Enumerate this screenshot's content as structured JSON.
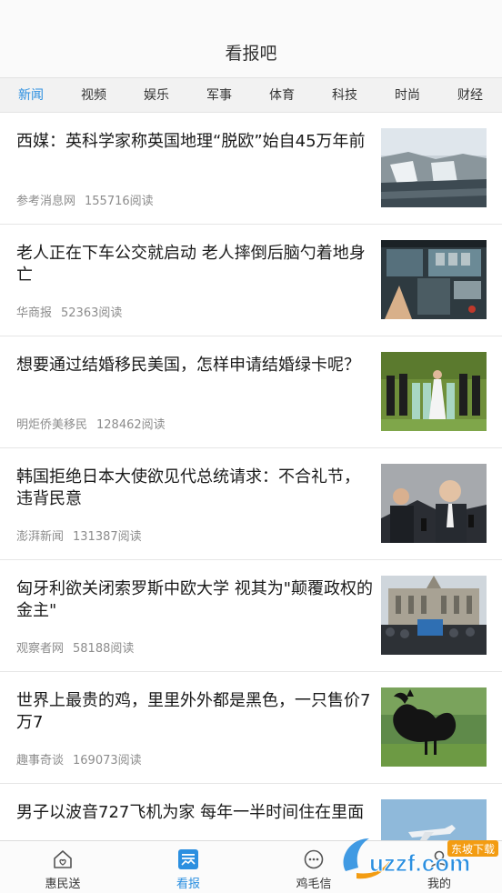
{
  "header": {
    "title": "看报吧"
  },
  "tabs": [
    {
      "label": "新闻",
      "active": true
    },
    {
      "label": "视频"
    },
    {
      "label": "娱乐"
    },
    {
      "label": "军事"
    },
    {
      "label": "体育"
    },
    {
      "label": "科技"
    },
    {
      "label": "时尚"
    },
    {
      "label": "财经"
    }
  ],
  "articles": [
    {
      "headline": "西媒：英科学家称英国地理“脱欧”始自45万年前",
      "source": "参考消息网",
      "reads": "155716阅读"
    },
    {
      "headline": "老人正在下车公交就启动 老人摔倒后脑勺着地身亡",
      "source": "华商报",
      "reads": "52363阅读"
    },
    {
      "headline": "想要通过结婚移民美国，怎样申请结婚绿卡呢？",
      "source": "明炬侨美移民",
      "reads": "128462阅读"
    },
    {
      "headline": "韩国拒绝日本大使欲见代总统请求：不合礼节，违背民意",
      "source": "澎湃新闻",
      "reads": "131387阅读"
    },
    {
      "headline": "匈牙利欲关闭索罗斯中欧大学 视其为\"颠覆政权的金主\"",
      "source": "观察者网",
      "reads": "58188阅读"
    },
    {
      "headline": "世界上最贵的鸡，里里外外都是黑色，一只售价7万7",
      "source": "趣事奇谈",
      "reads": "169073阅读"
    },
    {
      "headline": "男子以波音727飞机为家 每年一半时间住在里面",
      "source": "",
      "reads": ""
    }
  ],
  "tabbar": {
    "items": [
      {
        "label": "惠民送",
        "icon": "home-icon"
      },
      {
        "label": "看报",
        "icon": "newspaper-icon",
        "active": true
      },
      {
        "label": "鸡毛信",
        "icon": "chat-icon"
      },
      {
        "label": "我的",
        "icon": "profile-icon"
      }
    ]
  },
  "watermark": {
    "text": "uzzf.com",
    "tag": "东坡下载"
  },
  "colors": {
    "accent": "#2b8fe0",
    "meta": "#8c8c8c",
    "divider": "#e6e6e6"
  }
}
